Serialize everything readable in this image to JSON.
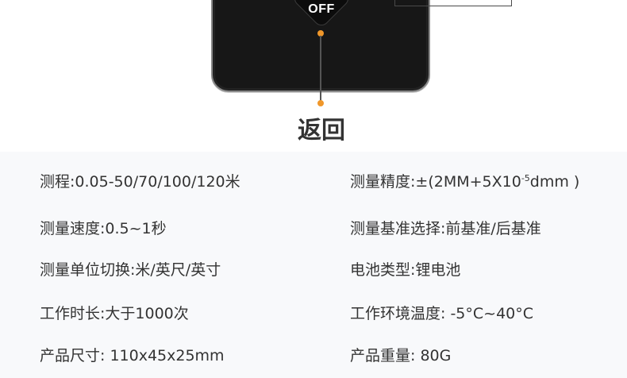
{
  "device": {
    "off_key_label": "OFF",
    "callout_label": "返回"
  },
  "specs": {
    "range": "测程:0.05-50/70/100/120米",
    "accuracy_prefix": "测量精度:±(2MM+5X10",
    "accuracy_exponent": "-5",
    "accuracy_suffix": "dmm )",
    "speed": "测量速度:0.5~1秒",
    "reference": "测量基准选择:前基准/后基准",
    "unit_switch": "测量单位切换:米/英尺/英寸",
    "battery": "电池类型:锂电池",
    "working_time": "工作时长:大于1000次",
    "working_temperature": "工作环境温度: -5°C~40°C",
    "size": "产品尺寸: 110x45x25mm",
    "weight": "产品重量: 80G"
  },
  "colors": {
    "accent_dot": "#f0972a",
    "spec_background": "#f8f9fb",
    "text": "#333333"
  }
}
